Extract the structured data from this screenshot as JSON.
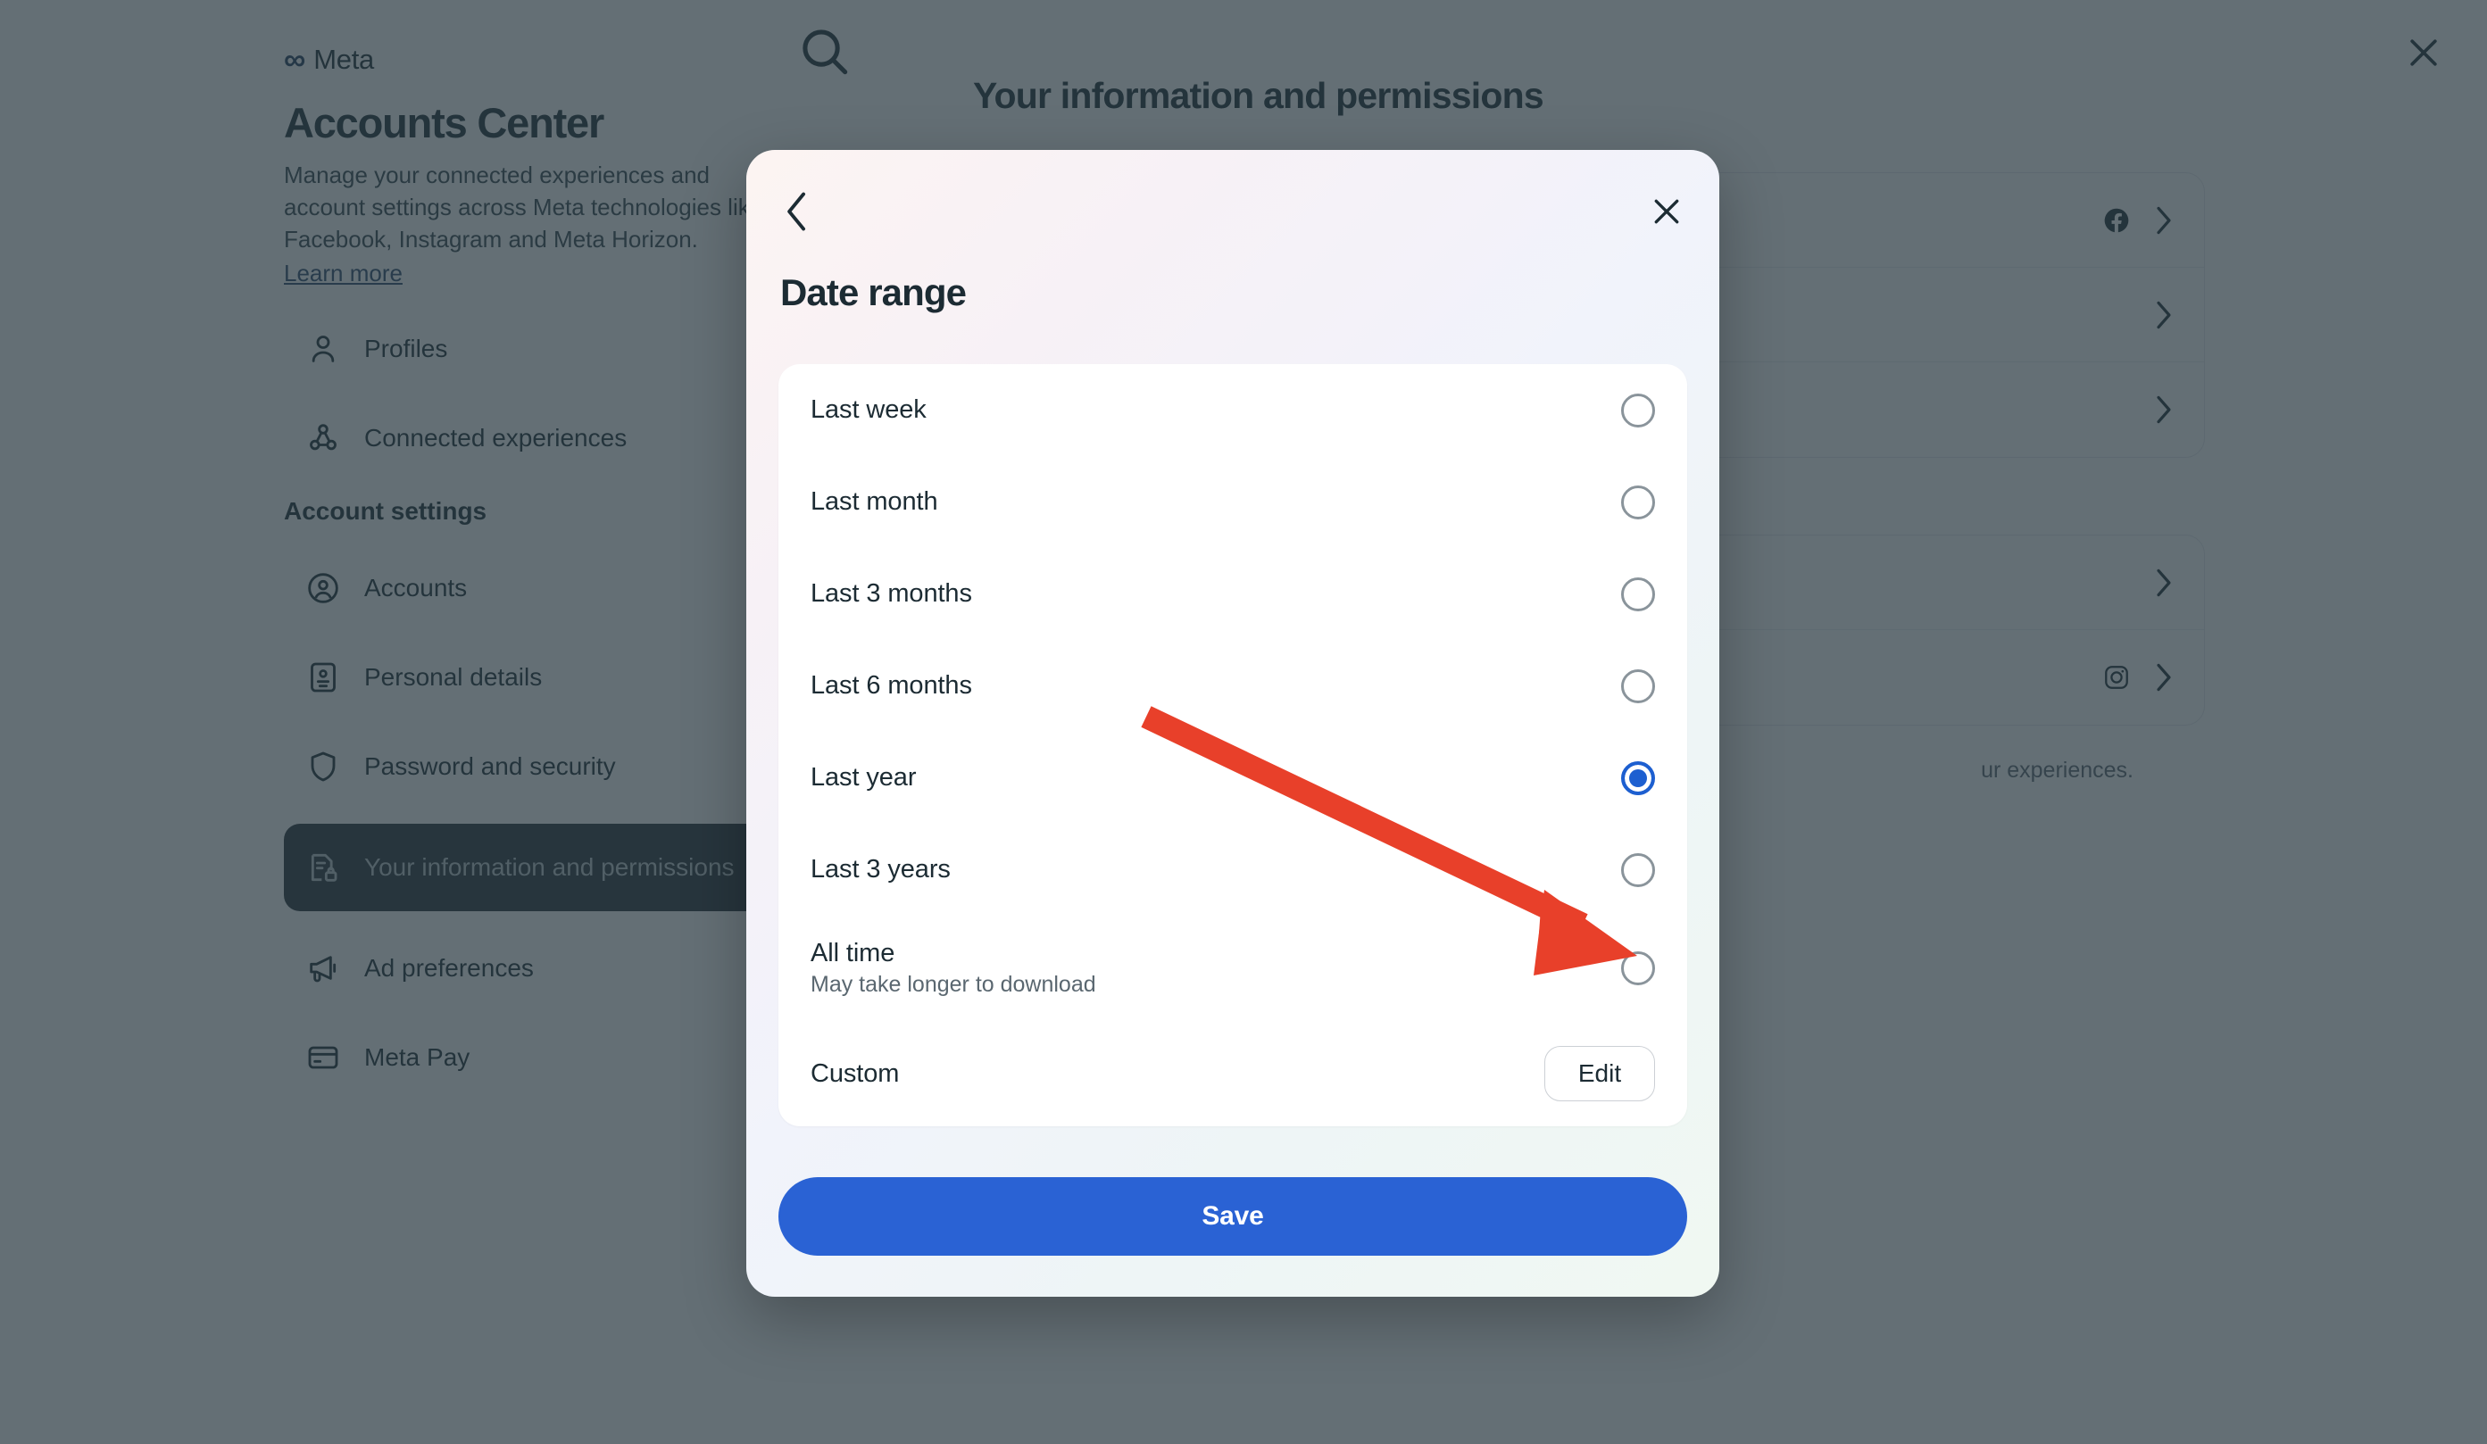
{
  "background": {
    "brand": {
      "logo_glyph": "∞",
      "logo_text": "Meta"
    },
    "page_title": "Accounts Center",
    "description": "Manage your connected experiences and account settings across Meta technologies like Facebook, Instagram and Meta Horizon.",
    "learn_more": "Learn more",
    "search_icon": "search-icon",
    "close_icon": "close-icon",
    "nav_primary": [
      {
        "label": "Profiles",
        "icon": "person-icon"
      },
      {
        "label": "Connected experiences",
        "icon": "connected-experiences-icon"
      }
    ],
    "nav_section_title": "Account settings",
    "nav_secondary": [
      {
        "label": "Accounts",
        "icon": "account-circle-icon",
        "active": false
      },
      {
        "label": "Personal details",
        "icon": "id-card-icon",
        "active": false
      },
      {
        "label": "Password and security",
        "icon": "shield-icon",
        "active": false
      },
      {
        "label": "Your information and permissions",
        "icon": "document-lock-icon",
        "active": true
      },
      {
        "label": "Ad preferences",
        "icon": "megaphone-icon",
        "active": false
      },
      {
        "label": "Meta Pay",
        "icon": "credit-card-icon",
        "active": false
      }
    ],
    "main_title": "Your information and permissions",
    "rows_card_1": [
      {
        "icon": "facebook-icon",
        "chevron": "chevron-right-icon"
      },
      {
        "icon": "",
        "chevron": "chevron-right-icon"
      },
      {
        "icon": "",
        "chevron": "chevron-right-icon"
      }
    ],
    "rows_card_2": [
      {
        "icon": "",
        "chevron": "chevron-right-icon"
      },
      {
        "icon": "instagram-icon",
        "chevron": "chevron-right-icon"
      }
    ],
    "footnote": "ur experiences."
  },
  "modal": {
    "back_icon": "chevron-left-icon",
    "close_icon": "close-icon",
    "title": "Date range",
    "options": [
      {
        "label": "Last week",
        "sub": "",
        "selected": false,
        "control": "radio"
      },
      {
        "label": "Last month",
        "sub": "",
        "selected": false,
        "control": "radio"
      },
      {
        "label": "Last 3 months",
        "sub": "",
        "selected": false,
        "control": "radio"
      },
      {
        "label": "Last 6 months",
        "sub": "",
        "selected": false,
        "control": "radio"
      },
      {
        "label": "Last year",
        "sub": "",
        "selected": true,
        "control": "radio"
      },
      {
        "label": "Last 3 years",
        "sub": "",
        "selected": false,
        "control": "radio"
      },
      {
        "label": "All time",
        "sub": "May take longer to download",
        "selected": false,
        "control": "radio"
      },
      {
        "label": "Custom",
        "sub": "",
        "selected": false,
        "control": "button",
        "button_label": "Edit"
      }
    ],
    "save_label": "Save"
  },
  "annotation": {
    "arrow_color": "#E8402A",
    "target": "all-time-radio"
  },
  "colors": {
    "accent_blue": "#2a62d4",
    "selected_radio": "#1d5fd0",
    "scrim": "#4a555d",
    "text_primary": "#1c2b33",
    "text_secondary": "#5a6770",
    "arrow_red": "#E8402A"
  }
}
